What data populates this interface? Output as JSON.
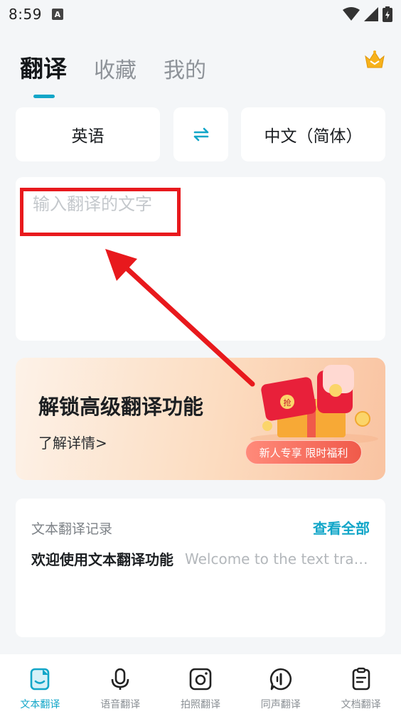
{
  "status_bar": {
    "time": "8:59",
    "notif_glyph": "A"
  },
  "header": {
    "tabs": [
      {
        "label": "翻译",
        "active": true
      },
      {
        "label": "收藏",
        "active": false
      },
      {
        "label": "我的",
        "active": false
      }
    ],
    "vip_icon": "crown-icon"
  },
  "language": {
    "source": "英语",
    "swap_icon": "swap-arrows-icon",
    "target": "中文（简体）"
  },
  "input": {
    "placeholder": "输入翻译的文字",
    "value": ""
  },
  "banner": {
    "title": "解锁高级翻译功能",
    "subtitle": "了解详情>",
    "badge": "新人专享 限时福利",
    "art_glyph": "抢"
  },
  "records": {
    "title": "文本翻译记录",
    "view_all": "查看全部",
    "items": [
      {
        "source": "欢迎使用文本翻译功能",
        "target": "Welcome to the text translation function"
      }
    ]
  },
  "bottom_nav": [
    {
      "label": "文本翻译",
      "icon": "text-translate-icon",
      "active": true
    },
    {
      "label": "语音翻译",
      "icon": "microphone-icon",
      "active": false
    },
    {
      "label": "拍照翻译",
      "icon": "camera-icon",
      "active": false
    },
    {
      "label": "同声翻译",
      "icon": "simultaneous-icon",
      "active": false
    },
    {
      "label": "文档翻译",
      "icon": "document-icon",
      "active": false
    }
  ],
  "colors": {
    "accent": "#12a6c8",
    "annotation_red": "#e8191d",
    "background": "#f4f6f8"
  }
}
